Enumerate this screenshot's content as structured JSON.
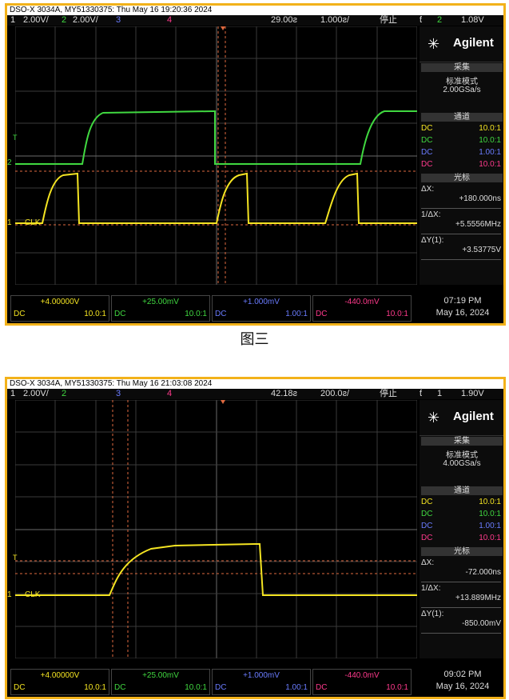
{
  "colors": {
    "frame": "#f2b21a",
    "ch1": "#f4e422",
    "ch2": "#40d840",
    "ch3": "#6a7cff",
    "ch4": "#ff3a8c",
    "grid": "#4a4a4a",
    "cursor": "#e06a40"
  },
  "caption": "图三",
  "scopes": [
    {
      "title": "DSO-X 3034A, MY51330375: Thu May 16 19:20:36 2024",
      "status": {
        "ch1_num": "1",
        "ch1_scale": "2.00V/",
        "ch2_num": "2",
        "ch2_scale": "2.00V/",
        "ch3_num": "3",
        "ch4_num": "4",
        "delay": "29.00ƨ",
        "timebase": "1.000ƨ/",
        "run_state": "停止",
        "trig_icon": "ƭ",
        "trig_src": "2",
        "trig_level": "1.08V"
      },
      "brand": "Agilent",
      "acq": {
        "header": "采集",
        "mode": "标准模式",
        "rate": "2.00GSa/s"
      },
      "channels_header": "通道",
      "channels": [
        {
          "coupling": "DC",
          "ratio": "10.0:1"
        },
        {
          "coupling": "DC",
          "ratio": "10.0:1"
        },
        {
          "coupling": "DC",
          "ratio": "1.00:1"
        },
        {
          "coupling": "DC",
          "ratio": "10.0:1"
        }
      ],
      "cursor_header": "光标",
      "cursors": {
        "dx_label": "ΔX:",
        "dx": "+180.000ns",
        "inv_label": "1/ΔX:",
        "inv": "+5.5556MHz",
        "dy_label": "ΔY(1):",
        "dy": "+3.53775V"
      },
      "bottom": [
        {
          "scale": "+4.00000V",
          "dc": "DC",
          "ratio": "10.0:1"
        },
        {
          "scale": "+25.00mV",
          "dc": "DC",
          "ratio": "10.0:1"
        },
        {
          "scale": "+1.000mV",
          "dc": "DC",
          "ratio": "1.00:1"
        },
        {
          "scale": "-440.0mV",
          "dc": "DC",
          "ratio": "10.0:1"
        }
      ],
      "time": "07:19 PM",
      "date": "May 16, 2024",
      "labels": {
        "clk": "CLK",
        "two": "2",
        "t": "T",
        "one": "1"
      }
    },
    {
      "title": "DSO-X 3034A, MY51330375: Thu May 16 21:03:08 2024",
      "status": {
        "ch1_num": "1",
        "ch1_scale": "2.00V/",
        "ch2_num": "2",
        "ch2_scale": "",
        "ch3_num": "3",
        "ch4_num": "4",
        "delay": "42.18ƨ",
        "timebase": "200.0ƨ/",
        "run_state": "停止",
        "trig_icon": "ƭ",
        "trig_src": "1",
        "trig_level": "1.90V"
      },
      "brand": "Agilent",
      "acq": {
        "header": "采集",
        "mode": "标准模式",
        "rate": "4.00GSa/s"
      },
      "channels_header": "通道",
      "channels": [
        {
          "coupling": "DC",
          "ratio": "10.0:1"
        },
        {
          "coupling": "DC",
          "ratio": "10.0:1"
        },
        {
          "coupling": "DC",
          "ratio": "1.00:1"
        },
        {
          "coupling": "DC",
          "ratio": "10.0:1"
        }
      ],
      "cursor_header": "光标",
      "cursors": {
        "dx_label": "ΔX:",
        "dx": "-72.000ns",
        "inv_label": "1/ΔX:",
        "inv": "+13.889MHz",
        "dy_label": "ΔY(1):",
        "dy": "-850.00mV"
      },
      "bottom": [
        {
          "scale": "+4.00000V",
          "dc": "DC",
          "ratio": "10.0:1"
        },
        {
          "scale": "+25.00mV",
          "dc": "DC",
          "ratio": "10.0:1"
        },
        {
          "scale": "+1.000mV",
          "dc": "DC",
          "ratio": "1.00:1"
        },
        {
          "scale": "-440.0mV",
          "dc": "DC",
          "ratio": "10.0:1"
        }
      ],
      "time": "09:02 PM",
      "date": "May 16, 2024",
      "labels": {
        "clk": "CLK",
        "two": "",
        "t": "T",
        "one": "1"
      }
    }
  ]
}
